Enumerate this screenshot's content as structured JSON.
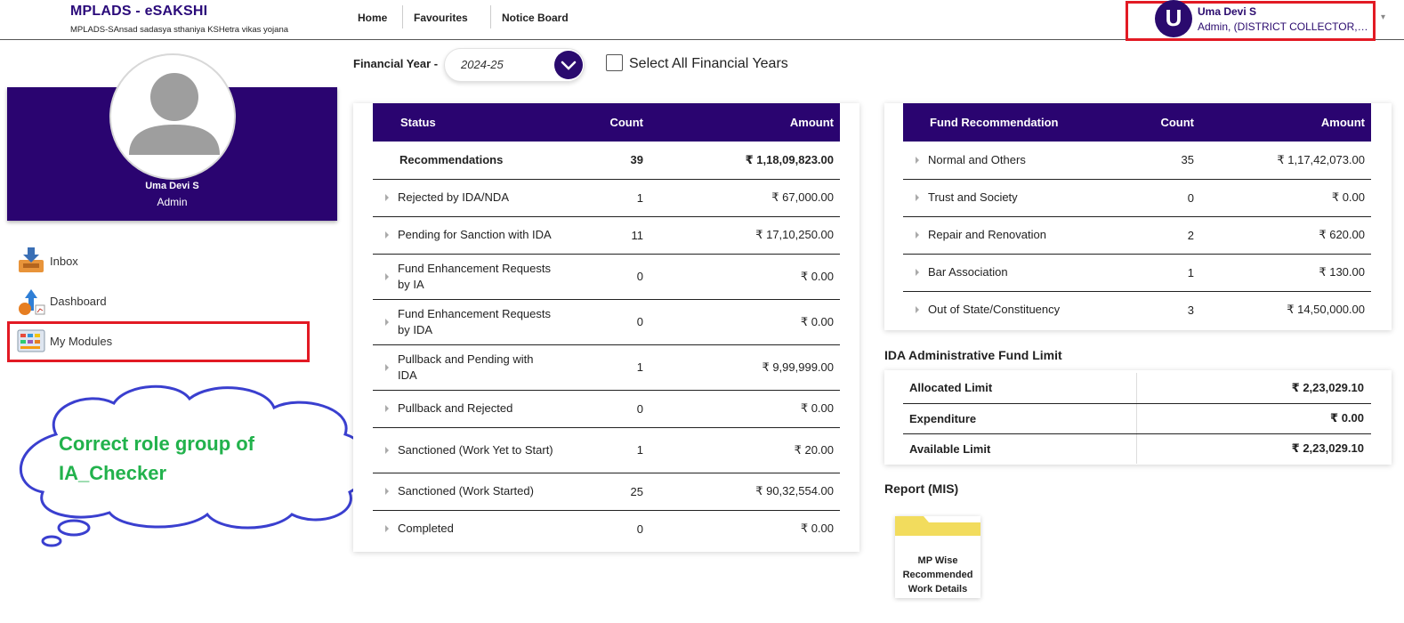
{
  "header": {
    "title": "MPLADS - eSAKSHI",
    "subtitle": "MPLADS-SAnsad sadasya sthaniya KSHetra vikas yojana",
    "nav": [
      "Home",
      "Favourites",
      "Notice Board"
    ],
    "user": {
      "initial": "U",
      "name": "Uma Devi S",
      "role": "Admin, (DISTRICT COLLECTOR, CHENNAI)"
    }
  },
  "profile": {
    "name": "Uma Devi S",
    "role": "Admin"
  },
  "sidebar": {
    "items": [
      {
        "label": "Inbox",
        "icon": "inbox-icon"
      },
      {
        "label": "Dashboard",
        "icon": "dashboard-icon"
      },
      {
        "label": "My Modules",
        "icon": "modules-icon"
      }
    ]
  },
  "annotation": {
    "text": "Correct role group of IA_Checker"
  },
  "filters": {
    "fy_label": "Financial Year -",
    "fy_value": "2024-25",
    "all_years_label": "Select All Financial Years",
    "all_years_checked": false
  },
  "status_table": {
    "headers": [
      "Status",
      "Count",
      "Amount"
    ],
    "rows": [
      {
        "label": "Recommendations",
        "count": "39",
        "amount": "₹ 1,18,09,823.00",
        "bold": true
      },
      {
        "label": "Rejected by IDA/NDA",
        "count": "1",
        "amount": "₹ 67,000.00"
      },
      {
        "label": "Pending for Sanction with IDA",
        "count": "11",
        "amount": "₹ 17,10,250.00"
      },
      {
        "label": "Fund Enhancement Requests by IA",
        "count": "0",
        "amount": "₹ 0.00"
      },
      {
        "label": "Fund Enhancement Requests by IDA",
        "count": "0",
        "amount": "₹ 0.00"
      },
      {
        "label": "Pullback and Pending with IDA",
        "count": "1",
        "amount": "₹ 9,99,999.00"
      },
      {
        "label": "Pullback and Rejected",
        "count": "0",
        "amount": "₹ 0.00"
      },
      {
        "label": "Sanctioned (Work Yet to Start)",
        "count": "1",
        "amount": "₹ 20.00"
      },
      {
        "label": "Sanctioned (Work Started)",
        "count": "25",
        "amount": "₹ 90,32,554.00"
      },
      {
        "label": "Completed",
        "count": "0",
        "amount": "₹ 0.00"
      }
    ]
  },
  "fund_table": {
    "headers": [
      "Fund Recommendation",
      "Count",
      "Amount"
    ],
    "rows": [
      {
        "label": "Normal and Others",
        "count": "35",
        "amount": "₹ 1,17,42,073.00"
      },
      {
        "label": "Trust and Society",
        "count": "0",
        "amount": "₹ 0.00"
      },
      {
        "label": "Repair and Renovation",
        "count": "2",
        "amount": "₹ 620.00"
      },
      {
        "label": "Bar Association",
        "count": "1",
        "amount": "₹ 130.00"
      },
      {
        "label": "Out of State/Constituency",
        "count": "3",
        "amount": "₹ 14,50,000.00"
      }
    ]
  },
  "ida_limit": {
    "title": "IDA Administrative Fund Limit",
    "rows": [
      {
        "label": "Allocated Limit",
        "amount": "₹ 2,23,029.10"
      },
      {
        "label": "Expenditure",
        "amount": "₹ 0.00"
      },
      {
        "label": "Available Limit",
        "amount": "₹ 2,23,029.10"
      }
    ]
  },
  "report": {
    "title": "Report (MIS)",
    "card_label": "MP Wise Recommended Work Details"
  },
  "colors": {
    "brand": "#2a0470",
    "highlight": "#e21a24",
    "annotation_text": "#22b24c",
    "cloud_stroke": "#3a3fcf"
  }
}
